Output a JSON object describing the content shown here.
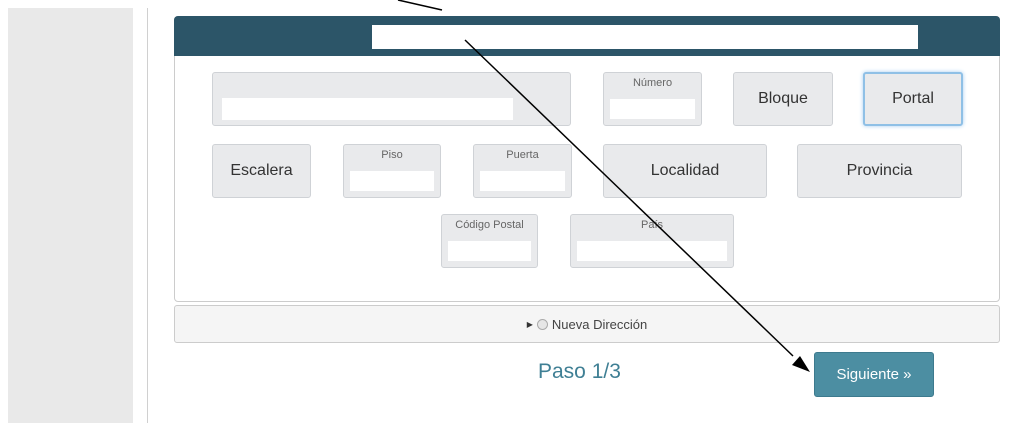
{
  "form": {
    "numero_label": "Número",
    "bloque_label": "Bloque",
    "portal_label": "Portal",
    "escalera_label": "Escalera",
    "piso_label": "Piso",
    "puerta_label": "Puerta",
    "localidad_label": "Localidad",
    "provincia_label": "Provincia",
    "codigo_postal_label": "Código Postal",
    "pais_label": "País"
  },
  "new_address": {
    "label": "Nueva Dirección"
  },
  "footer": {
    "step_text": "Paso 1/3",
    "next_label": "Siguiente »"
  },
  "colors": {
    "header": "#2c5568",
    "accent": "#4c8ea2",
    "step_text": "#3f7f94"
  }
}
